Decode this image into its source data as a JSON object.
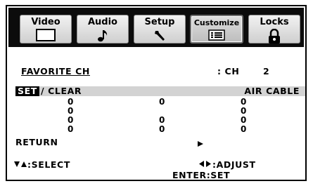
{
  "tabs": [
    {
      "label": "Video",
      "icon": "monitor-icon",
      "selected": false
    },
    {
      "label": "Audio",
      "icon": "music-note-icon",
      "selected": false
    },
    {
      "label": "Setup",
      "icon": "wrench-icon",
      "selected": false
    },
    {
      "label": "Customize",
      "icon": "list-icon",
      "selected": true
    },
    {
      "label": "Locks",
      "icon": "padlock-icon",
      "selected": false
    }
  ],
  "favorite": {
    "title": "FAVORITE CH",
    "ch_label": ": CH",
    "ch_value": "2"
  },
  "setclear": {
    "set": "SET",
    "rest": "/ CLEAR",
    "source": "AIR CABLE"
  },
  "channels": {
    "col1": [
      "0",
      "0",
      "0",
      "0"
    ],
    "col2": [
      "0",
      "0",
      "0"
    ],
    "col3": [
      "0",
      "0",
      "0",
      "0"
    ]
  },
  "return_label": "RETURN",
  "footer": {
    "select": ":SELECT",
    "adjust": ":ADJUST",
    "enter": "ENTER:SET"
  },
  "colors": {
    "tab_background": "#0c0c0c",
    "set_bar": "#d3d3d3"
  }
}
